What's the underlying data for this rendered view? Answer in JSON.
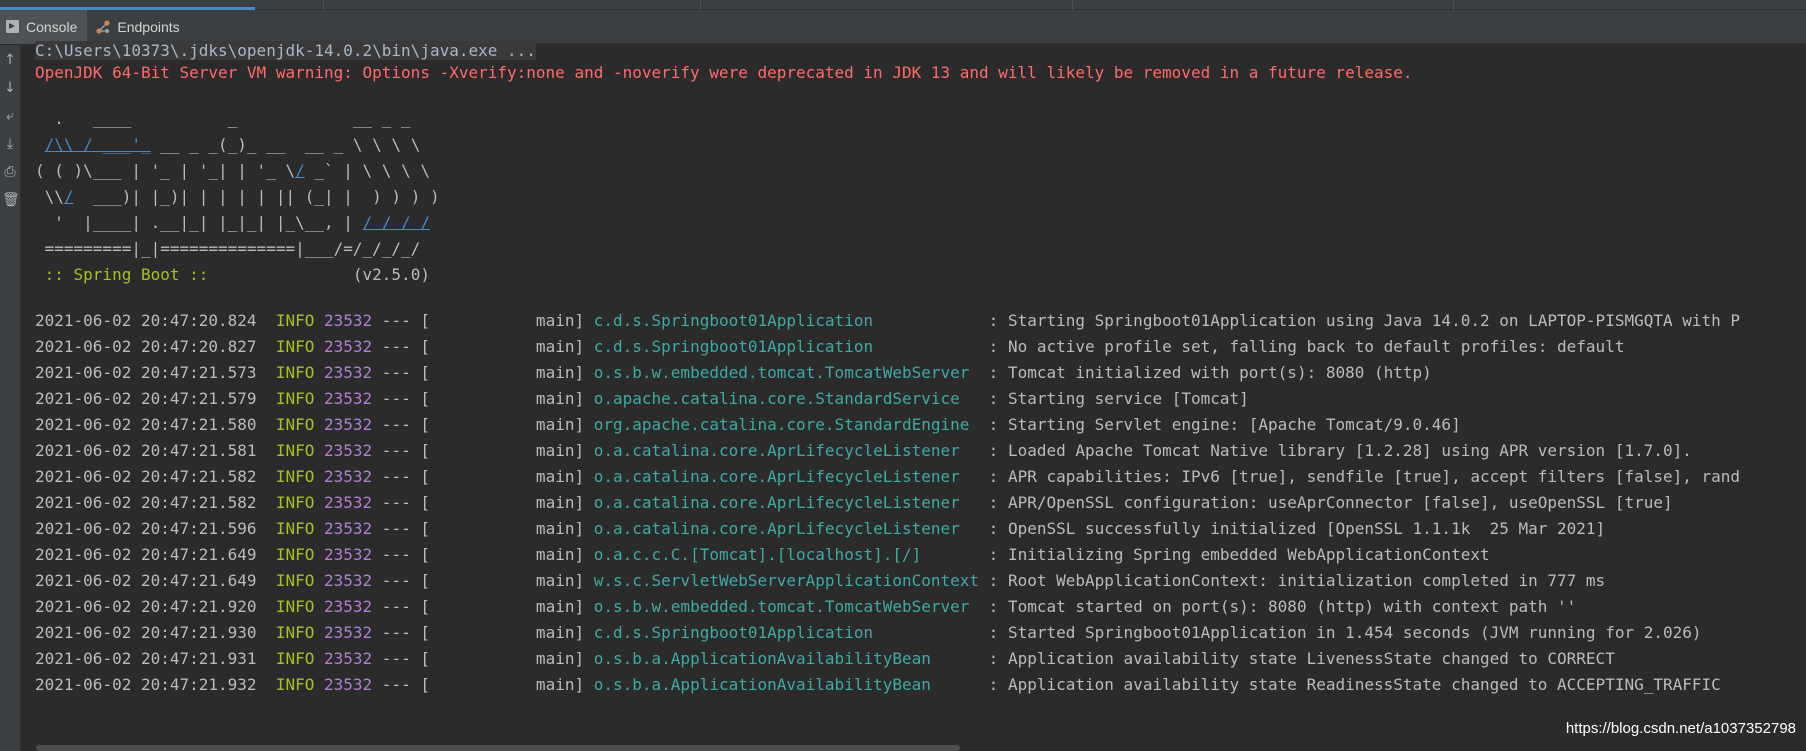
{
  "tabs": [
    {
      "label": "Console",
      "icon": "console-icon",
      "selected": true
    },
    {
      "label": "Endpoints",
      "icon": "endpoints-icon",
      "selected": false
    }
  ],
  "toolbar_icons": [
    "arrow-up-icon",
    "arrow-down-icon",
    "soft-wrap-icon",
    "scroll-to-end-icon",
    "print-icon",
    "trash-icon"
  ],
  "console": {
    "command": "C:\\Users\\10373\\.jdks\\openjdk-14.0.2\\bin\\java.exe ...",
    "warning": "OpenJDK 64-Bit Server VM warning: Options -Xverify:none and -noverify were deprecated in JDK 13 and will likely be removed in a future release.",
    "banner": [
      "  .   ____          _            __ _ _",
      " /\\\\ / ___'_ __ _ _(_)_ __  __ _ \\ \\ \\ \\",
      "( ( )\\___ | '_ | '_| | '_ \\/ _` | \\ \\ \\ \\",
      " \\\\/  ___)| |_)| | | | | || (_| |  ) ) ) )",
      "  '  |____| .__|_| |_|_| |_\\__, | / / / /",
      " =========|_|==============|___/=/_/_/_/"
    ],
    "spring_label": " :: Spring Boot :: ",
    "spring_version": "              (v2.5.0)",
    "logs": [
      {
        "ts": "2021-06-02 20:47:20.824",
        "level": "INFO",
        "pid": "23532",
        "thread": "main",
        "logger": "c.d.s.Springboot01Application",
        "msg": "Starting Springboot01Application using Java 14.0.2 on LAPTOP-PISMGQTA with P"
      },
      {
        "ts": "2021-06-02 20:47:20.827",
        "level": "INFO",
        "pid": "23532",
        "thread": "main",
        "logger": "c.d.s.Springboot01Application",
        "msg": "No active profile set, falling back to default profiles: default"
      },
      {
        "ts": "2021-06-02 20:47:21.573",
        "level": "INFO",
        "pid": "23532",
        "thread": "main",
        "logger": "o.s.b.w.embedded.tomcat.TomcatWebServer",
        "msg": "Tomcat initialized with port(s): 8080 (http)"
      },
      {
        "ts": "2021-06-02 20:47:21.579",
        "level": "INFO",
        "pid": "23532",
        "thread": "main",
        "logger": "o.apache.catalina.core.StandardService",
        "msg": "Starting service [Tomcat]"
      },
      {
        "ts": "2021-06-02 20:47:21.580",
        "level": "INFO",
        "pid": "23532",
        "thread": "main",
        "logger": "org.apache.catalina.core.StandardEngine",
        "msg": "Starting Servlet engine: [Apache Tomcat/9.0.46]"
      },
      {
        "ts": "2021-06-02 20:47:21.581",
        "level": "INFO",
        "pid": "23532",
        "thread": "main",
        "logger": "o.a.catalina.core.AprLifecycleListener",
        "msg": "Loaded Apache Tomcat Native library [1.2.28] using APR version [1.7.0]."
      },
      {
        "ts": "2021-06-02 20:47:21.582",
        "level": "INFO",
        "pid": "23532",
        "thread": "main",
        "logger": "o.a.catalina.core.AprLifecycleListener",
        "msg": "APR capabilities: IPv6 [true], sendfile [true], accept filters [false], rand"
      },
      {
        "ts": "2021-06-02 20:47:21.582",
        "level": "INFO",
        "pid": "23532",
        "thread": "main",
        "logger": "o.a.catalina.core.AprLifecycleListener",
        "msg": "APR/OpenSSL configuration: useAprConnector [false], useOpenSSL [true]"
      },
      {
        "ts": "2021-06-02 20:47:21.596",
        "level": "INFO",
        "pid": "23532",
        "thread": "main",
        "logger": "o.a.catalina.core.AprLifecycleListener",
        "msg": "OpenSSL successfully initialized [OpenSSL 1.1.1k  25 Mar 2021]"
      },
      {
        "ts": "2021-06-02 20:47:21.649",
        "level": "INFO",
        "pid": "23532",
        "thread": "main",
        "logger": "o.a.c.c.C.[Tomcat].[localhost].[/]",
        "msg": "Initializing Spring embedded WebApplicationContext"
      },
      {
        "ts": "2021-06-02 20:47:21.649",
        "level": "INFO",
        "pid": "23532",
        "thread": "main",
        "logger": "w.s.c.ServletWebServerApplicationContext",
        "msg": "Root WebApplicationContext: initialization completed in 777 ms"
      },
      {
        "ts": "2021-06-02 20:47:21.920",
        "level": "INFO",
        "pid": "23532",
        "thread": "main",
        "logger": "o.s.b.w.embedded.tomcat.TomcatWebServer",
        "msg": "Tomcat started on port(s): 8080 (http) with context path ''"
      },
      {
        "ts": "2021-06-02 20:47:21.930",
        "level": "INFO",
        "pid": "23532",
        "thread": "main",
        "logger": "c.d.s.Springboot01Application",
        "msg": "Started Springboot01Application in 1.454 seconds (JVM running for 2.026)"
      },
      {
        "ts": "2021-06-02 20:47:21.931",
        "level": "INFO",
        "pid": "23532",
        "thread": "main",
        "logger": "o.s.b.a.ApplicationAvailabilityBean",
        "msg": "Application availability state LivenessState changed to CORRECT"
      },
      {
        "ts": "2021-06-02 20:47:21.932",
        "level": "INFO",
        "pid": "23532",
        "thread": "main",
        "logger": "o.s.b.a.ApplicationAvailabilityBean",
        "msg": "Application availability state ReadinessState changed to ACCEPTING_TRAFFIC"
      }
    ]
  },
  "watermark": "https://blog.csdn.net/a1037352798",
  "colors": {
    "background": "#2b2b2b",
    "warning": "#ff6b68",
    "info": "#a8c023",
    "pid": "#b27fd0",
    "logger": "#3faaa2",
    "banner_accent": "#4a88c7"
  }
}
